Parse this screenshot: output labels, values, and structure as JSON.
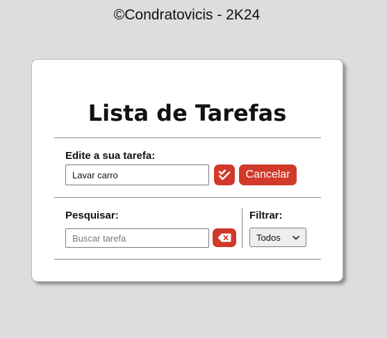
{
  "credit": "©Condratovicis - 2K24",
  "app": {
    "title": "Lista de Tarefas"
  },
  "edit_section": {
    "label": "Edite a sua tarefa:",
    "input_value": "Lavar carro",
    "confirm_icon": "double-check-icon",
    "cancel_label": "Cancelar"
  },
  "search_section": {
    "label": "Pesquisar:",
    "placeholder": "Buscar tarefa",
    "clear_icon": "backspace-icon"
  },
  "filter_section": {
    "label": "Filtrar:",
    "selected": "Todos",
    "dropdown_icon": "chevron-down-icon"
  },
  "colors": {
    "accent": "#d13a2a",
    "background": "#dcdddc",
    "card": "#ffffff"
  }
}
